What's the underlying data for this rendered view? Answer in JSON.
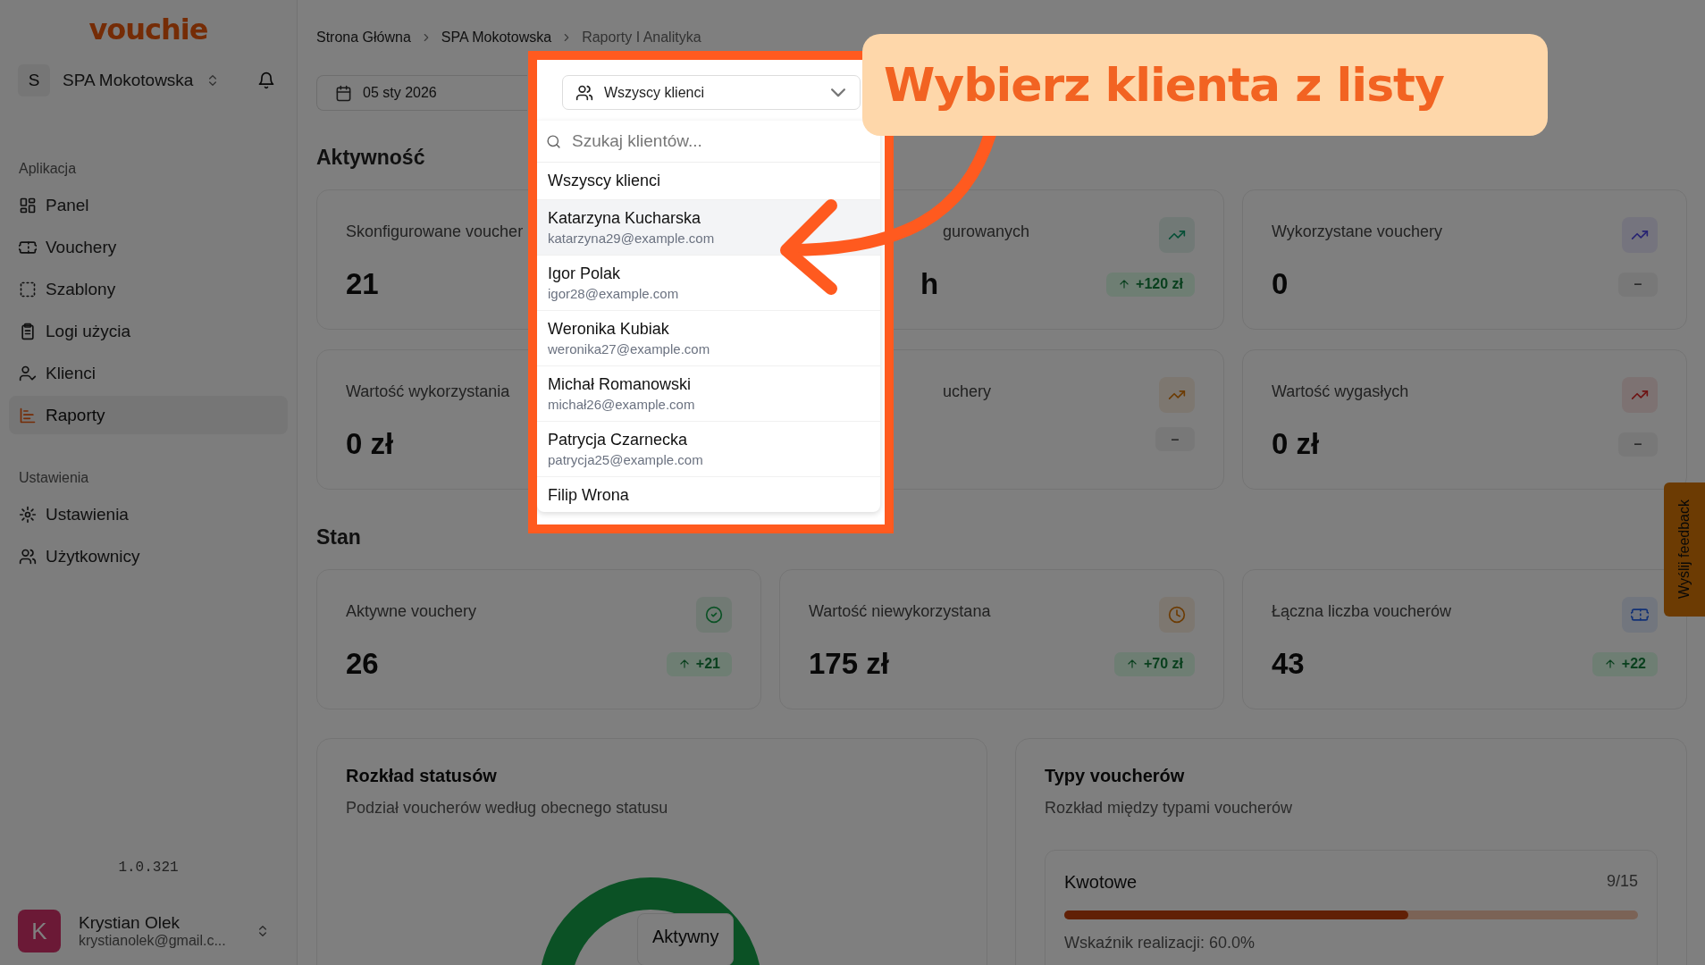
{
  "sidebar": {
    "logo": "vouchie",
    "workspace": {
      "initial": "S",
      "name": "SPA Mokotowska"
    },
    "sections": [
      {
        "title": "Aplikacja",
        "items": [
          {
            "label": "Panel",
            "selected": false
          },
          {
            "label": "Vouchery",
            "selected": false
          },
          {
            "label": "Szablony",
            "selected": false
          },
          {
            "label": "Logi użycia",
            "selected": false
          },
          {
            "label": "Klienci",
            "selected": false
          },
          {
            "label": "Raporty",
            "selected": true
          }
        ]
      },
      {
        "title": "Ustawienia",
        "items": [
          {
            "label": "Ustawienia",
            "selected": false
          },
          {
            "label": "Użytkownicy",
            "selected": false
          }
        ]
      }
    ],
    "version": "1.0.321",
    "user": {
      "initial": "K",
      "name": "Krystian Olek",
      "email": "krystianolek@gmail.c..."
    }
  },
  "breadcrumb": [
    {
      "label": "Strona Główna",
      "current": false
    },
    {
      "label": "SPA Mokotowska",
      "current": false
    },
    {
      "label": "Raporty I Analityka",
      "current": true
    }
  ],
  "toolbar": {
    "date": "05 sty 2026"
  },
  "client_picker": {
    "value": "Wszyscy klienci",
    "expanded": true,
    "placeholder": "Szukaj klientów...",
    "options": [
      {
        "name": "Wszyscy klienci",
        "highlighted": false
      },
      {
        "name": "Katarzyna Kucharska",
        "email": "katarzyna29@example.com",
        "highlighted": true
      },
      {
        "name": "Igor Polak",
        "email": "igor28@example.com",
        "highlighted": false
      },
      {
        "name": "Weronika Kubiak",
        "email": "weronika27@example.com",
        "highlighted": false
      },
      {
        "name": "Michał Romanowski",
        "email": "michał26@example.com",
        "highlighted": false
      },
      {
        "name": "Patrycja Czarnecka",
        "email": "patrycja25@example.com",
        "highlighted": false
      },
      {
        "name": "Filip Wrona",
        "highlighted": false
      }
    ]
  },
  "activity": {
    "title": "Aktywność",
    "cards": [
      {
        "title": "Skonfigurowane voucher",
        "value": "21"
      },
      {
        "title": "gurowanych",
        "value": "h",
        "badge": {
          "text": "+120 zł",
          "increase": true
        }
      },
      {
        "title": "Wykorzystane vouchery",
        "value": "0",
        "badge": {
          "text": "–",
          "increase": false
        }
      },
      {
        "title": "Wartość wykorzystania",
        "value": "0 zł"
      },
      {
        "title": "uchery",
        "badge": {
          "text": "–",
          "increase": false
        }
      },
      {
        "title": "Wartość wygasłych",
        "value": "0 zł",
        "badge": {
          "text": "–",
          "increase": false
        }
      }
    ]
  },
  "status": {
    "title": "Stan",
    "cards": [
      {
        "title": "Aktywne vouchery",
        "value": "26",
        "badge": {
          "text": "+21",
          "increase": true
        }
      },
      {
        "title": "Wartość niewykorzystana",
        "value": "175 zł",
        "badge": {
          "text": "+70 zł",
          "increase": true
        }
      },
      {
        "title": "Łączna liczba voucherów",
        "value": "43",
        "badge": {
          "text": "+22",
          "increase": true
        }
      }
    ]
  },
  "status_panel": {
    "title": "Rozkład statusów",
    "subtitle": "Podział voucherów według obecnego statusu",
    "tooltip": "Aktywny"
  },
  "types_panel": {
    "title": "Typy voucherów",
    "subtitle": "Rozkład między typami voucherów",
    "types": [
      {
        "name": "Kwotowe",
        "count": "9/15",
        "level": 0.6,
        "rate": "Wskaźnik realizacji: 60.0%"
      }
    ]
  },
  "callout": "Wybierz klienta z listy",
  "feedback": "Wyślij feedback"
}
